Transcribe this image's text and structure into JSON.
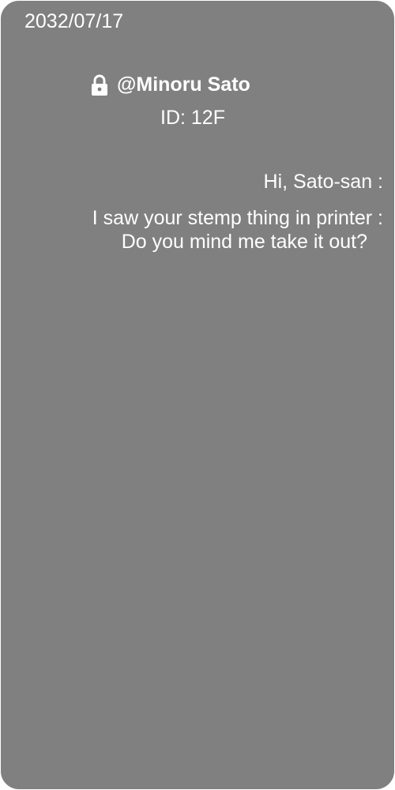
{
  "status": {
    "date": "2032/07/17"
  },
  "contact": {
    "name": "@Minoru Sato",
    "id_text": "ID: 12F",
    "icon": "lock-icon"
  },
  "message": {
    "greeting": "Hi, Sato-san :",
    "line1": "I saw your stemp thing in printer :",
    "line2": "Do you mind me take it out?"
  },
  "colors": {
    "background": "#808080",
    "text": "#ffffff"
  }
}
